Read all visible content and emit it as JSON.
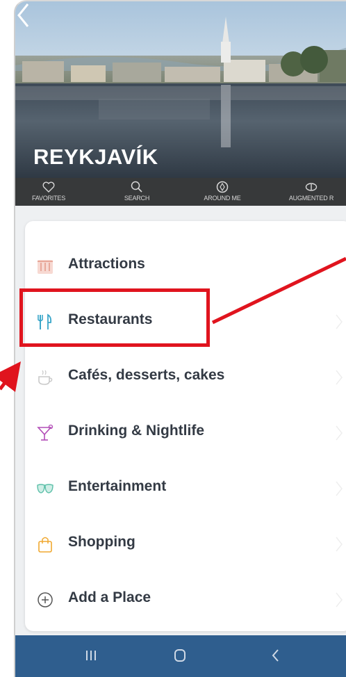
{
  "header": {
    "title": "REYKJAVÍK",
    "back_icon": "chevron-left-icon"
  },
  "tabs": [
    {
      "label": "FAVORITES",
      "icon": "heart-icon"
    },
    {
      "label": "SEARCH",
      "icon": "search-icon"
    },
    {
      "label": "AROUND ME",
      "icon": "compass-icon"
    },
    {
      "label": "AUGMENTED R",
      "icon": "eye-icon"
    }
  ],
  "categories": [
    {
      "label": "Attractions",
      "icon": "museum-icon",
      "color": "#e8a89a"
    },
    {
      "label": "Restaurants",
      "icon": "cutlery-icon",
      "color": "#3aa6c9"
    },
    {
      "label": "Cafés, desserts, cakes",
      "icon": "coffee-cup-icon",
      "color": "#c9c9c9"
    },
    {
      "label": "Drinking & Nightlife",
      "icon": "cocktail-icon",
      "color": "#b24db7"
    },
    {
      "label": "Entertainment",
      "icon": "theater-masks-icon",
      "color": "#5bbfa8"
    },
    {
      "label": "Shopping",
      "icon": "shopping-bag-icon",
      "color": "#f0a830"
    },
    {
      "label": "Add a Place",
      "icon": "plus-circle-icon",
      "color": "#555555"
    }
  ],
  "nav": {
    "recent_icon": "recent-apps-icon",
    "home_icon": "home-icon",
    "back_icon": "back-icon"
  },
  "colors": {
    "tabbar": "#37393a",
    "navbar": "#2f5e8e",
    "highlight": "#e0141e"
  }
}
